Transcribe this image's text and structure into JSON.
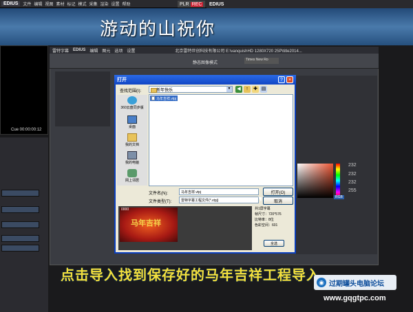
{
  "top_bar": {
    "logo": "EDIUS",
    "menu": [
      "文件",
      "编辑",
      "视图",
      "素材",
      "标记",
      "模式",
      "采集",
      "渲染",
      "设置",
      "帮助"
    ],
    "plr": "PLR",
    "rec": "REC"
  },
  "right_bar": {
    "logo": "EDIUS"
  },
  "banner_title": "游动的山祝你",
  "left_monitor": {
    "cue": "Cue 00:00:00:12"
  },
  "titler": {
    "title": "雷特字幕",
    "logo": "EDIUS",
    "menu": [
      "编辑",
      "图元",
      "选项",
      "设置"
    ],
    "path": "北京雷特世创科技有限公司 E:\\vanquishHD 1280X720 25P\\title2014...",
    "font_label": "Times New Ro",
    "checkbox_label": "静态图像模式",
    "numbers": [
      "232",
      "232",
      "232",
      "255"
    ],
    "rgb_label": "RGB"
  },
  "dialog": {
    "title": "打开",
    "lookin_label": "查找范围(I):",
    "lookin_value": "新年快乐",
    "places": [
      {
        "label": "360云盘同步版",
        "icon": "cloud-icon"
      },
      {
        "label": "桌面",
        "icon": "desktop-icon"
      },
      {
        "label": "我的文档",
        "icon": "documents-icon"
      },
      {
        "label": "我的电脑",
        "icon": "computer-icon"
      },
      {
        "label": "网上邻居",
        "icon": "network-icon"
      }
    ],
    "file_item": "马年吉祥.vtpj",
    "filename_label": "文件名(N):",
    "filename_value": "马年吉祥.vtpj",
    "filetype_label": "文件类型(T):",
    "filetype_value": "雷特字幕工程文件(*.vtpj)",
    "open_button": "打开(O)",
    "cancel_button": "取消",
    "help_button": "?",
    "close_button": "×",
    "preview": {
      "code": "0000",
      "title": "马年吉祥",
      "info": [
        "共1屏字幕",
        "",
        "帧尺寸：720*576",
        "比特率：8位",
        "色彩空间：601"
      ],
      "all_button": "全选"
    }
  },
  "caption": "点击导入找到保存好的马年吉祥工程导入",
  "watermark": {
    "text": "过期罐头电脑论坛",
    "url": "www.gqgtpc.com"
  }
}
